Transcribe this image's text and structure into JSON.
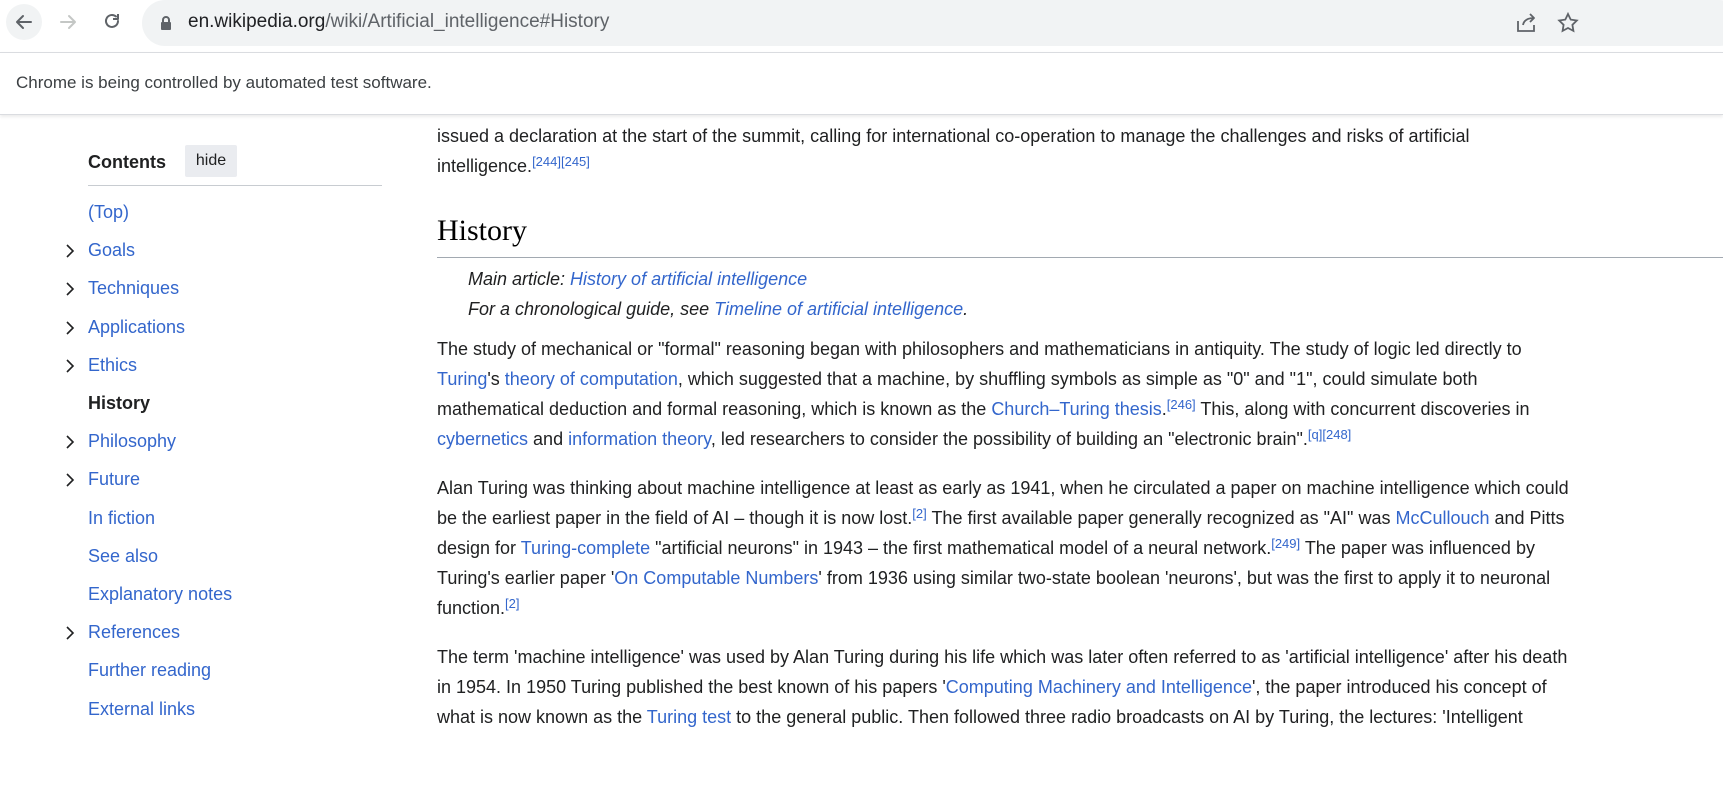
{
  "browser": {
    "url_host": "en.wikipedia.org",
    "url_path": "/wiki/Artificial_intelligence#History",
    "infobar_text": "Chrome is being controlled by automated test software."
  },
  "toc": {
    "title": "Contents",
    "hide_label": "hide",
    "items": [
      {
        "label": "(Top)",
        "expandable": false
      },
      {
        "label": "Goals",
        "expandable": true
      },
      {
        "label": "Techniques",
        "expandable": true
      },
      {
        "label": "Applications",
        "expandable": true
      },
      {
        "label": "Ethics",
        "expandable": true
      },
      {
        "label": "History",
        "expandable": false,
        "current": true
      },
      {
        "label": "Philosophy",
        "expandable": true
      },
      {
        "label": "Future",
        "expandable": true
      },
      {
        "label": "In fiction",
        "expandable": false
      },
      {
        "label": "See also",
        "expandable": false
      },
      {
        "label": "Explanatory notes",
        "expandable": false
      },
      {
        "label": "References",
        "expandable": true
      },
      {
        "label": "Further reading",
        "expandable": false
      },
      {
        "label": "External links",
        "expandable": false
      }
    ]
  },
  "article": {
    "intro_line1": "issued a declaration at the start of the summit, calling for international co-operation to manage the challenges and risks of artificial",
    "intro_line2": "intelligence.",
    "intro_refs": "[244][245]",
    "heading": "History",
    "hat1_prefix": "Main article: ",
    "hat1_link": "History of artificial intelligence",
    "hat2_prefix": "For a chronological guide, see ",
    "hat2_link": "Timeline of artificial intelligence",
    "hat2_suffix": ".",
    "p1": {
      "l1": "The study of mechanical or \"formal\" reasoning began with philosophers and mathematicians in antiquity. The study of logic led directly to",
      "l2_link1": "Turing",
      "l2_t1": "'s ",
      "l2_link2": "theory of computation",
      "l2_t2": ", which suggested that a machine, by shuffling symbols as simple as \"0\" and \"1\", could simulate both",
      "l3_t1": "mathematical deduction and formal reasoning, which is known as the ",
      "l3_link": "Church–Turing thesis",
      "l3_ref": "[246]",
      "l3_t2": " This, along with concurrent discoveries in",
      "l4_link1": "cybernetics",
      "l4_t1": " and ",
      "l4_link2": "information theory",
      "l4_t2": ", led researchers to consider the possibility of building an \"electronic brain\".",
      "l4_ref": "[q][248]"
    },
    "p2": {
      "l1": "Alan Turing was thinking about machine intelligence at least as early as 1941, when he circulated a paper on machine intelligence which could",
      "l2_t1": "be the earliest paper in the field of AI – though it is now lost.",
      "l2_ref": "[2]",
      "l2_t2": " The first available paper generally recognized as \"AI\" was ",
      "l2_link": "McCullouch",
      "l2_t3": " and Pitts",
      "l3_t1": "design for ",
      "l3_link": "Turing-complete",
      "l3_t2": " \"artificial neurons\" in 1943 – the first mathematical model of a neural network.",
      "l3_ref": "[249]",
      "l3_t3": " The paper was influenced by",
      "l4_t1": "Turing's earlier paper '",
      "l4_link": "On Computable Numbers",
      "l4_t2": "' from 1936 using similar two-state boolean 'neurons', but was the first to apply it to neuronal",
      "l5_t1": "function.",
      "l5_ref": "[2]"
    },
    "p3": {
      "l1": "The term 'machine intelligence' was used by Alan Turing during his life which was later often referred to as 'artificial intelligence' after his death",
      "l2_t1": "in 1954. In 1950 Turing published the best known of his papers '",
      "l2_link": "Computing Machinery and Intelligence",
      "l2_t2": "', the paper introduced his concept of",
      "l3_t1": "what is now known as the ",
      "l3_link": "Turing test",
      "l3_t2": " to the general public. Then followed three radio broadcasts on AI by Turing, the lectures: 'Intelligent"
    }
  }
}
